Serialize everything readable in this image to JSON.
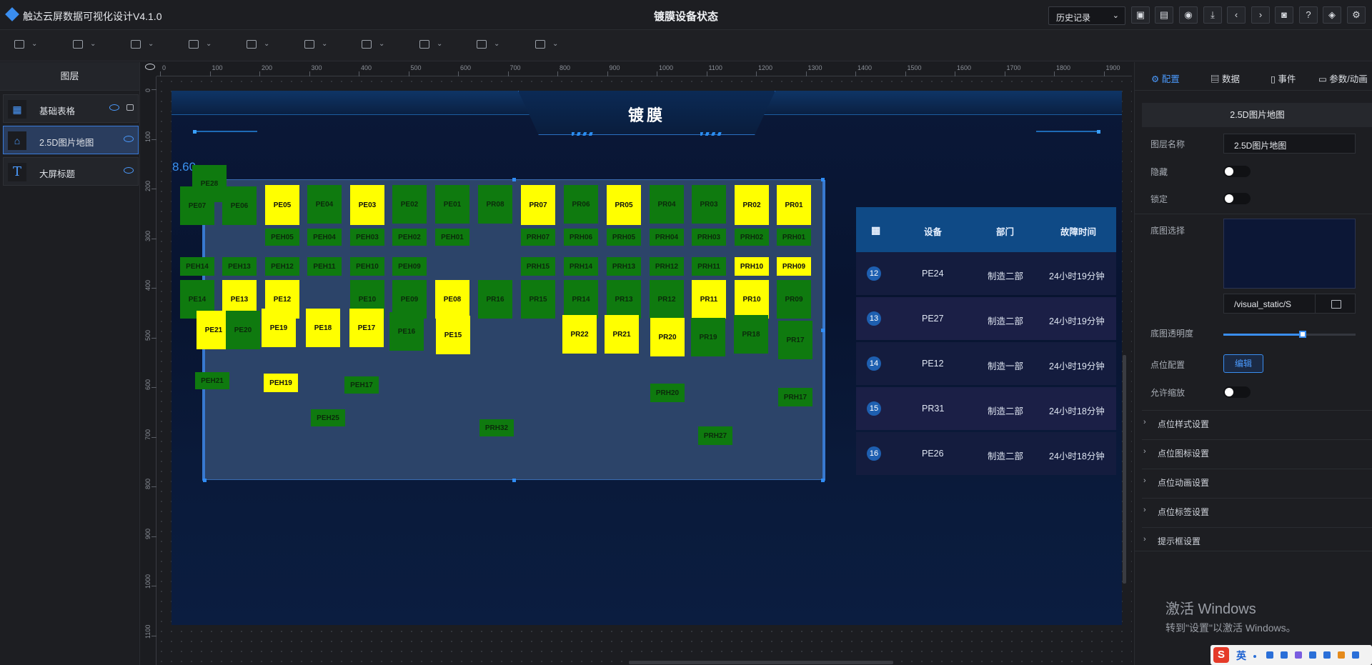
{
  "app": {
    "title": "触达云屏数据可视化设计V4.1.0",
    "page_title": "镀膜设备状态"
  },
  "header": {
    "history_label": "历史记录",
    "icons": [
      "save-icon",
      "save-as-icon",
      "preview-icon",
      "download-icon",
      "undo-icon",
      "redo-icon",
      "screenshot-icon",
      "help-icon",
      "layers-icon",
      "settings-icon"
    ]
  },
  "toolbar": [
    "chart-tool",
    "map-tool",
    "text-tool",
    "media-tool",
    "line-chart-tool",
    "table-tool",
    "decor-tool",
    "control-tool",
    "interaction-tool",
    "grid-tool"
  ],
  "layers_panel": {
    "title": "图层",
    "items": [
      {
        "label": "基础表格",
        "icon": "table-icon"
      },
      {
        "label": "2.5D图片地图",
        "icon": "map-icon"
      },
      {
        "label": "大屏标题",
        "icon": "text-icon"
      }
    ]
  },
  "ruler": {
    "h_ticks": [
      "0",
      "100",
      "200",
      "300",
      "400",
      "500",
      "600",
      "700",
      "800",
      "900",
      "1000",
      "1100",
      "1200",
      "1300",
      "1400",
      "1500",
      "1600",
      "1700",
      "1800",
      "1900"
    ],
    "v_ticks": [
      "0",
      "100",
      "200",
      "300",
      "400",
      "500",
      "600",
      "700",
      "800",
      "900",
      "1000",
      "1100"
    ]
  },
  "canvas": {
    "screen_title": "镀膜",
    "scale_label": "8.60",
    "points": [
      {
        "label": "PE07",
        "state": "normal"
      },
      {
        "label": "PE28",
        "state": "normal"
      },
      {
        "label": "PE06",
        "state": "normal"
      },
      {
        "label": "PE05",
        "state": "fault"
      },
      {
        "label": "PE04",
        "state": "normal"
      },
      {
        "label": "PE03",
        "state": "fault"
      },
      {
        "label": "PE02",
        "state": "normal"
      },
      {
        "label": "PE01",
        "state": "normal"
      },
      {
        "label": "PR08",
        "state": "normal"
      },
      {
        "label": "PR07",
        "state": "fault"
      },
      {
        "label": "PR06",
        "state": "normal"
      },
      {
        "label": "PR05",
        "state": "fault"
      },
      {
        "label": "PR04",
        "state": "normal"
      },
      {
        "label": "PR03",
        "state": "normal"
      },
      {
        "label": "PR02",
        "state": "fault"
      },
      {
        "label": "PR01",
        "state": "fault"
      },
      {
        "label": "PEH05",
        "state": "normal"
      },
      {
        "label": "PEH04",
        "state": "normal"
      },
      {
        "label": "PEH03",
        "state": "normal"
      },
      {
        "label": "PEH02",
        "state": "normal"
      },
      {
        "label": "PEH01",
        "state": "normal"
      },
      {
        "label": "PRH07",
        "state": "normal"
      },
      {
        "label": "PRH06",
        "state": "normal"
      },
      {
        "label": "PRH05",
        "state": "normal"
      },
      {
        "label": "PRH04",
        "state": "normal"
      },
      {
        "label": "PRH03",
        "state": "normal"
      },
      {
        "label": "PRH02",
        "state": "normal"
      },
      {
        "label": "PRH01",
        "state": "normal"
      },
      {
        "label": "PEH14",
        "state": "normal"
      },
      {
        "label": "PEH13",
        "state": "normal"
      },
      {
        "label": "PEH12",
        "state": "normal"
      },
      {
        "label": "PEH11",
        "state": "normal"
      },
      {
        "label": "PEH10",
        "state": "normal"
      },
      {
        "label": "PEH09",
        "state": "normal"
      },
      {
        "label": "PRH15",
        "state": "normal"
      },
      {
        "label": "PRH14",
        "state": "normal"
      },
      {
        "label": "PRH13",
        "state": "normal"
      },
      {
        "label": "PRH12",
        "state": "normal"
      },
      {
        "label": "PRH11",
        "state": "normal"
      },
      {
        "label": "PRH10",
        "state": "fault"
      },
      {
        "label": "PRH09",
        "state": "fault"
      },
      {
        "label": "PE14",
        "state": "normal"
      },
      {
        "label": "PE13",
        "state": "fault"
      },
      {
        "label": "PE12",
        "state": "fault"
      },
      {
        "label": "PE10",
        "state": "normal"
      },
      {
        "label": "PE09",
        "state": "normal"
      },
      {
        "label": "PE08",
        "state": "fault"
      },
      {
        "label": "PR16",
        "state": "normal"
      },
      {
        "label": "PR15",
        "state": "normal"
      },
      {
        "label": "PR14",
        "state": "normal"
      },
      {
        "label": "PR13",
        "state": "normal"
      },
      {
        "label": "PR12",
        "state": "normal"
      },
      {
        "label": "PR11",
        "state": "fault"
      },
      {
        "label": "PR10",
        "state": "fault"
      },
      {
        "label": "PR09",
        "state": "normal"
      },
      {
        "label": "PE21",
        "state": "fault"
      },
      {
        "label": "PE20",
        "state": "normal"
      },
      {
        "label": "PE19",
        "state": "fault"
      },
      {
        "label": "PE18",
        "state": "fault"
      },
      {
        "label": "PE17",
        "state": "fault"
      },
      {
        "label": "PE16",
        "state": "normal"
      },
      {
        "label": "PE15",
        "state": "fault"
      },
      {
        "label": "PR22",
        "state": "fault"
      },
      {
        "label": "PR21",
        "state": "fault"
      },
      {
        "label": "PR20",
        "state": "fault"
      },
      {
        "label": "PR19",
        "state": "normal"
      },
      {
        "label": "PR18",
        "state": "normal"
      },
      {
        "label": "PR17",
        "state": "normal"
      },
      {
        "label": "PEH21",
        "state": "normal"
      },
      {
        "label": "PEH19",
        "state": "fault"
      },
      {
        "label": "PEH17",
        "state": "normal"
      },
      {
        "label": "PRH20",
        "state": "normal"
      },
      {
        "label": "PRH17",
        "state": "normal"
      },
      {
        "label": "PEH25",
        "state": "normal"
      },
      {
        "label": "PRH32",
        "state": "normal"
      },
      {
        "label": "PRH27",
        "state": "normal"
      }
    ],
    "table": {
      "header_icon": "grid-icon",
      "columns": [
        "设备",
        "部门",
        "故障时间"
      ],
      "rows": [
        {
          "idx": "12",
          "device": "PE24",
          "dept": "制造二部",
          "time": "24小时19分钟"
        },
        {
          "idx": "13",
          "device": "PE27",
          "dept": "制造二部",
          "time": "24小时19分钟"
        },
        {
          "idx": "14",
          "device": "PE12",
          "dept": "制造一部",
          "time": "24小时19分钟"
        },
        {
          "idx": "15",
          "device": "PR31",
          "dept": "制造二部",
          "time": "24小时18分钟"
        },
        {
          "idx": "16",
          "device": "PE26",
          "dept": "制造二部",
          "time": "24小时18分钟"
        }
      ]
    },
    "colors": {
      "normal": "#0f7a0f",
      "fault": "#ffff00",
      "accent": "#3a8ef0"
    }
  },
  "right_panel": {
    "tabs": [
      "配置",
      "数据",
      "事件",
      "参数/动画"
    ],
    "section_title": "2.5D图片地图",
    "layer_name_label": "图层名称",
    "layer_name_value": "2.5D图片地图",
    "hide_label": "隐藏",
    "lock_label": "锁定",
    "bg_select_label": "底图选择",
    "bg_path": "/visual_static/S",
    "bg_opacity_label": "底图透明度",
    "bg_opacity": 0.6,
    "point_config_label": "点位配置",
    "edit_label": "编辑",
    "allow_zoom_label": "允许缩放",
    "sections": [
      "点位样式设置",
      "点位图标设置",
      "点位动画设置",
      "点位标签设置",
      "提示框设置"
    ]
  },
  "system": {
    "watermark_line1": "激活 Windows",
    "watermark_line2": "转到\"设置\"以激活 Windows。",
    "ime_label": "英"
  }
}
